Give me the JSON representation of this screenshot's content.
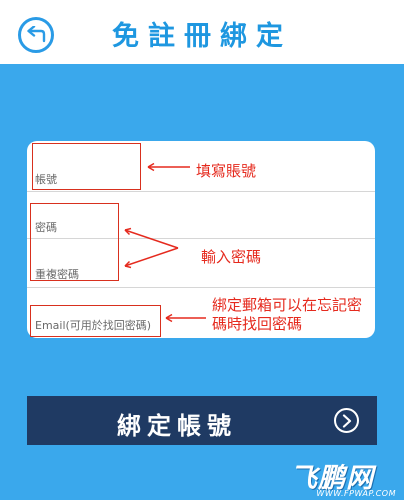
{
  "header": {
    "title": "免註冊綁定",
    "back_icon": "back-arrow-icon"
  },
  "form": {
    "fields": [
      {
        "label": "帳號"
      },
      {
        "label": "密碼"
      },
      {
        "label": "重複密碼"
      },
      {
        "label": "Email(可用於找回密碼)"
      }
    ]
  },
  "annotations": {
    "account": "填寫賬號",
    "password": "輸入密碼",
    "email_line1": "綁定郵箱可以在忘記密",
    "email_line2": "碼時找回密碼"
  },
  "bind_button": {
    "label": "綁定帳號",
    "icon": "chevron-right-circle-icon"
  },
  "watermark": {
    "logo": "飞鹏网",
    "url": "WWW.FPWAP.COM"
  },
  "colors": {
    "background": "#3aa8ec",
    "title": "#1e97e0",
    "button": "#1f3a63",
    "annotation": "#e52a1e"
  }
}
